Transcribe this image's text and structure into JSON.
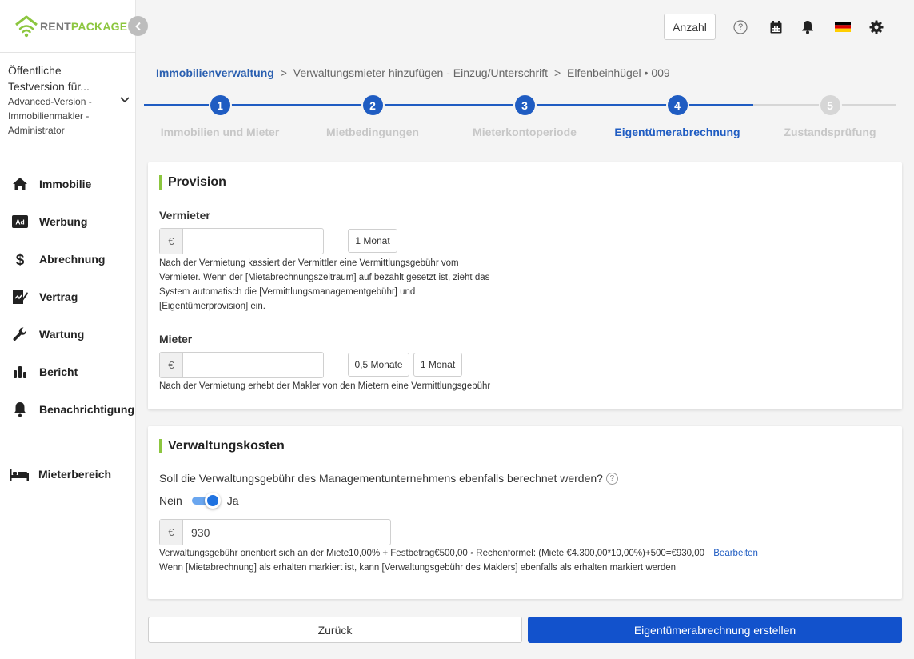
{
  "brand": {
    "part1": "RENT",
    "part2": "PACKAGE"
  },
  "account": {
    "line1": "Öffentliche",
    "line2": "Testversion für...",
    "line3": "Advanced-Version -",
    "line4": "Immobilienmakler -",
    "line5": "Administrator"
  },
  "nav": {
    "items": [
      {
        "label": "Immobilie",
        "icon": "home-icon"
      },
      {
        "label": "Werbung",
        "icon": "ad-icon"
      },
      {
        "label": "Abrechnung",
        "icon": "dollar-icon"
      },
      {
        "label": "Vertrag",
        "icon": "contract-icon"
      },
      {
        "label": "Wartung",
        "icon": "wrench-icon"
      },
      {
        "label": "Bericht",
        "icon": "bar-chart-icon"
      },
      {
        "label": "Benachrichtigung",
        "icon": "bell-icon"
      }
    ],
    "tenant": {
      "label": "Mieterbereich",
      "icon": "bed-icon"
    }
  },
  "header": {
    "anzahl_label": "Anzahl",
    "help_glyph": "?"
  },
  "breadcrumb": {
    "root": "Immobilienverwaltung",
    "sep": ">",
    "item2": "Verwaltungsmieter hinzufügen - Einzug/Unterschrift",
    "item3": "Elfenbeinhügel • 009"
  },
  "steps": [
    {
      "num": "1",
      "label": "Immobilien und Mieter"
    },
    {
      "num": "2",
      "label": "Mietbedingungen"
    },
    {
      "num": "3",
      "label": "Mieterkontoperiode"
    },
    {
      "num": "4",
      "label": "Eigentümerabrechnung"
    },
    {
      "num": "5",
      "label": "Zustandsprüfung"
    }
  ],
  "colors": {
    "accent": "#1f5cc2",
    "brand_green": "#8cc63f",
    "step_done": "#1f5cc2",
    "step_pending": "#d6d6d6",
    "primary_button": "#1252cc"
  },
  "provision": {
    "title": "Provision",
    "currency": "€",
    "landlord": {
      "label": "Vermieter",
      "value": "",
      "chip1": "1 Monat",
      "help1": "Nach der Vermietung kassiert der Vermittler eine Vermittlungsgebühr vom",
      "help2": "Vermieter. Wenn der [Mietabrechnungszeitraum] auf bezahlt gesetzt ist, zieht das",
      "help3": "System automatisch die [Vermittlungsmanagementgebühr] und",
      "help4": "[Eigentümerprovision] ein."
    },
    "tenant": {
      "label": "Mieter",
      "value": "",
      "chip1": "0,5 Monate",
      "chip2": "1 Monat",
      "help": "Nach der Vermietung erhebt der Makler von den Mietern eine Vermittlungsgebühr"
    }
  },
  "management": {
    "title": "Verwaltungskosten",
    "question": "Soll die Verwaltungsgebühr des Managementunternehmens ebenfalls berechnet werden?",
    "q_glyph": "?",
    "no": "Nein",
    "yes": "Ja",
    "toggle_on": true,
    "currency": "€",
    "value": "930",
    "fee_text": "Verwaltungsgebühr orientiert sich an der Miete10,00% + Festbetrag€500,00 ◦ Rechenformel: (Miete €4.300,00*10,00%)+500=€930,00",
    "edit_label": "Bearbeiten",
    "note": "Wenn [Mietabrechnung] als erhalten markiert ist, kann [Verwaltungsgebühr des Maklers] ebenfalls als erhalten markiert werden"
  },
  "actions": {
    "back": "Zurück",
    "submit": "Eigentümerabrechnung erstellen"
  }
}
